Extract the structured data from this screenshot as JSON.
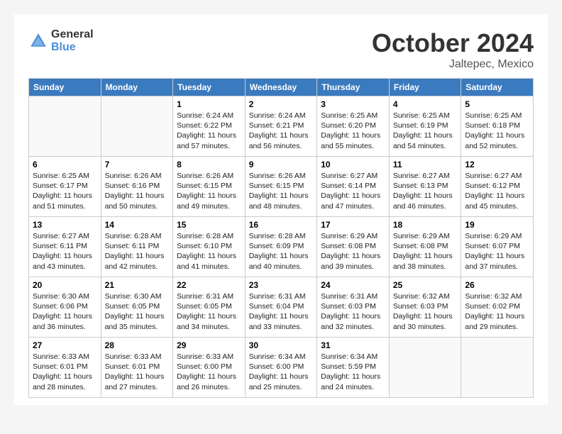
{
  "header": {
    "logo_general": "General",
    "logo_blue": "Blue",
    "month": "October 2024",
    "location": "Jaltepec, Mexico"
  },
  "days_of_week": [
    "Sunday",
    "Monday",
    "Tuesday",
    "Wednesday",
    "Thursday",
    "Friday",
    "Saturday"
  ],
  "weeks": [
    [
      {
        "day": "",
        "sunrise": "",
        "sunset": "",
        "daylight": ""
      },
      {
        "day": "",
        "sunrise": "",
        "sunset": "",
        "daylight": ""
      },
      {
        "day": "1",
        "sunrise": "Sunrise: 6:24 AM",
        "sunset": "Sunset: 6:22 PM",
        "daylight": "Daylight: 11 hours and 57 minutes."
      },
      {
        "day": "2",
        "sunrise": "Sunrise: 6:24 AM",
        "sunset": "Sunset: 6:21 PM",
        "daylight": "Daylight: 11 hours and 56 minutes."
      },
      {
        "day": "3",
        "sunrise": "Sunrise: 6:25 AM",
        "sunset": "Sunset: 6:20 PM",
        "daylight": "Daylight: 11 hours and 55 minutes."
      },
      {
        "day": "4",
        "sunrise": "Sunrise: 6:25 AM",
        "sunset": "Sunset: 6:19 PM",
        "daylight": "Daylight: 11 hours and 54 minutes."
      },
      {
        "day": "5",
        "sunrise": "Sunrise: 6:25 AM",
        "sunset": "Sunset: 6:18 PM",
        "daylight": "Daylight: 11 hours and 52 minutes."
      }
    ],
    [
      {
        "day": "6",
        "sunrise": "Sunrise: 6:25 AM",
        "sunset": "Sunset: 6:17 PM",
        "daylight": "Daylight: 11 hours and 51 minutes."
      },
      {
        "day": "7",
        "sunrise": "Sunrise: 6:26 AM",
        "sunset": "Sunset: 6:16 PM",
        "daylight": "Daylight: 11 hours and 50 minutes."
      },
      {
        "day": "8",
        "sunrise": "Sunrise: 6:26 AM",
        "sunset": "Sunset: 6:15 PM",
        "daylight": "Daylight: 11 hours and 49 minutes."
      },
      {
        "day": "9",
        "sunrise": "Sunrise: 6:26 AM",
        "sunset": "Sunset: 6:15 PM",
        "daylight": "Daylight: 11 hours and 48 minutes."
      },
      {
        "day": "10",
        "sunrise": "Sunrise: 6:27 AM",
        "sunset": "Sunset: 6:14 PM",
        "daylight": "Daylight: 11 hours and 47 minutes."
      },
      {
        "day": "11",
        "sunrise": "Sunrise: 6:27 AM",
        "sunset": "Sunset: 6:13 PM",
        "daylight": "Daylight: 11 hours and 46 minutes."
      },
      {
        "day": "12",
        "sunrise": "Sunrise: 6:27 AM",
        "sunset": "Sunset: 6:12 PM",
        "daylight": "Daylight: 11 hours and 45 minutes."
      }
    ],
    [
      {
        "day": "13",
        "sunrise": "Sunrise: 6:27 AM",
        "sunset": "Sunset: 6:11 PM",
        "daylight": "Daylight: 11 hours and 43 minutes."
      },
      {
        "day": "14",
        "sunrise": "Sunrise: 6:28 AM",
        "sunset": "Sunset: 6:11 PM",
        "daylight": "Daylight: 11 hours and 42 minutes."
      },
      {
        "day": "15",
        "sunrise": "Sunrise: 6:28 AM",
        "sunset": "Sunset: 6:10 PM",
        "daylight": "Daylight: 11 hours and 41 minutes."
      },
      {
        "day": "16",
        "sunrise": "Sunrise: 6:28 AM",
        "sunset": "Sunset: 6:09 PM",
        "daylight": "Daylight: 11 hours and 40 minutes."
      },
      {
        "day": "17",
        "sunrise": "Sunrise: 6:29 AM",
        "sunset": "Sunset: 6:08 PM",
        "daylight": "Daylight: 11 hours and 39 minutes."
      },
      {
        "day": "18",
        "sunrise": "Sunrise: 6:29 AM",
        "sunset": "Sunset: 6:08 PM",
        "daylight": "Daylight: 11 hours and 38 minutes."
      },
      {
        "day": "19",
        "sunrise": "Sunrise: 6:29 AM",
        "sunset": "Sunset: 6:07 PM",
        "daylight": "Daylight: 11 hours and 37 minutes."
      }
    ],
    [
      {
        "day": "20",
        "sunrise": "Sunrise: 6:30 AM",
        "sunset": "Sunset: 6:06 PM",
        "daylight": "Daylight: 11 hours and 36 minutes."
      },
      {
        "day": "21",
        "sunrise": "Sunrise: 6:30 AM",
        "sunset": "Sunset: 6:05 PM",
        "daylight": "Daylight: 11 hours and 35 minutes."
      },
      {
        "day": "22",
        "sunrise": "Sunrise: 6:31 AM",
        "sunset": "Sunset: 6:05 PM",
        "daylight": "Daylight: 11 hours and 34 minutes."
      },
      {
        "day": "23",
        "sunrise": "Sunrise: 6:31 AM",
        "sunset": "Sunset: 6:04 PM",
        "daylight": "Daylight: 11 hours and 33 minutes."
      },
      {
        "day": "24",
        "sunrise": "Sunrise: 6:31 AM",
        "sunset": "Sunset: 6:03 PM",
        "daylight": "Daylight: 11 hours and 32 minutes."
      },
      {
        "day": "25",
        "sunrise": "Sunrise: 6:32 AM",
        "sunset": "Sunset: 6:03 PM",
        "daylight": "Daylight: 11 hours and 30 minutes."
      },
      {
        "day": "26",
        "sunrise": "Sunrise: 6:32 AM",
        "sunset": "Sunset: 6:02 PM",
        "daylight": "Daylight: 11 hours and 29 minutes."
      }
    ],
    [
      {
        "day": "27",
        "sunrise": "Sunrise: 6:33 AM",
        "sunset": "Sunset: 6:01 PM",
        "daylight": "Daylight: 11 hours and 28 minutes."
      },
      {
        "day": "28",
        "sunrise": "Sunrise: 6:33 AM",
        "sunset": "Sunset: 6:01 PM",
        "daylight": "Daylight: 11 hours and 27 minutes."
      },
      {
        "day": "29",
        "sunrise": "Sunrise: 6:33 AM",
        "sunset": "Sunset: 6:00 PM",
        "daylight": "Daylight: 11 hours and 26 minutes."
      },
      {
        "day": "30",
        "sunrise": "Sunrise: 6:34 AM",
        "sunset": "Sunset: 6:00 PM",
        "daylight": "Daylight: 11 hours and 25 minutes."
      },
      {
        "day": "31",
        "sunrise": "Sunrise: 6:34 AM",
        "sunset": "Sunset: 5:59 PM",
        "daylight": "Daylight: 11 hours and 24 minutes."
      },
      {
        "day": "",
        "sunrise": "",
        "sunset": "",
        "daylight": ""
      },
      {
        "day": "",
        "sunrise": "",
        "sunset": "",
        "daylight": ""
      }
    ]
  ]
}
